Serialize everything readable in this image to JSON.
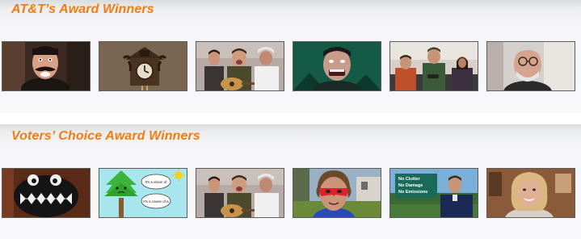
{
  "sections": [
    {
      "title": "AT&T’s Award Winners",
      "thumbnails": [
        {
          "icon": "mustache-man-thumbnail"
        },
        {
          "icon": "cuckoo-clock-thumbnail"
        },
        {
          "icon": "three-men-guitar-thumbnail"
        },
        {
          "icon": "screaming-man-thumbnail"
        },
        {
          "icon": "gamers-couch-thumbnail"
        },
        {
          "icon": "old-man-glasses-thumbnail"
        }
      ]
    },
    {
      "title": "Voters’ Choice Award Winners",
      "thumbnails": [
        {
          "icon": "monster-mouth-thumbnail"
        },
        {
          "icon": "cartoon-tree-thumbnail",
          "bubbles": [
            "It's a vision of",
            "It's a cause of a"
          ]
        },
        {
          "icon": "three-men-guitar-thumbnail"
        },
        {
          "icon": "red-masked-man-thumbnail"
        },
        {
          "icon": "sign-man-thumbnail",
          "sign_lines": [
            "No Clutter",
            "No Damage",
            "No Emissions"
          ]
        },
        {
          "icon": "smiling-woman-thumbnail"
        }
      ]
    }
  ],
  "colors": {
    "title": "#f07d10",
    "thumb_border": "#5c5c5c"
  }
}
